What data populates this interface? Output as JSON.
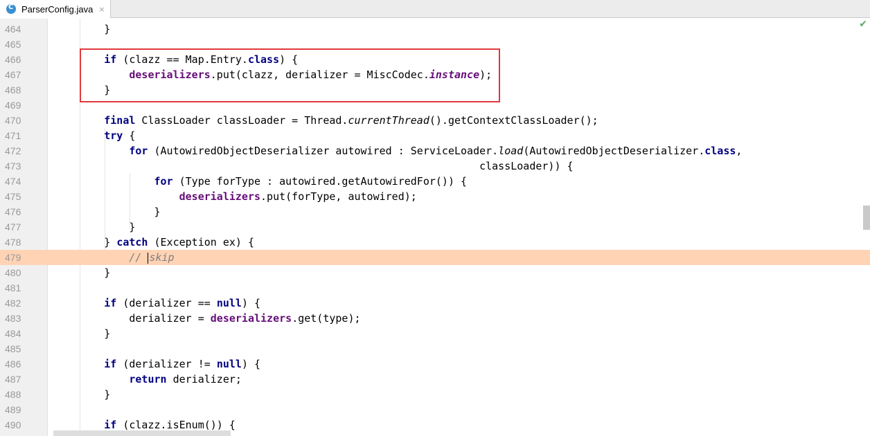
{
  "tab": {
    "icon": "java-class-icon",
    "icon_letter": "C",
    "label": "ParserConfig.java",
    "close": "×"
  },
  "status": {
    "check": "✔"
  },
  "lines": [
    {
      "num": "464",
      "html": "        }"
    },
    {
      "num": "465",
      "html": ""
    },
    {
      "num": "466",
      "html": "        <span class=\"kw\">if</span> (clazz == Map.Entry.<span class=\"kw\">class</span>) {"
    },
    {
      "num": "467",
      "html": "            <span class=\"fld\">deserializers</span>.put(clazz, derializer = MiscCodec.<span class=\"fldi\">instance</span>);"
    },
    {
      "num": "468",
      "html": "        }"
    },
    {
      "num": "469",
      "html": ""
    },
    {
      "num": "470",
      "html": "        <span class=\"kw\">final</span> ClassLoader classLoader = Thread.<span class=\"ita\">currentThread</span>().getContextClassLoader();"
    },
    {
      "num": "471",
      "html": "        <span class=\"kw\">try</span> {"
    },
    {
      "num": "472",
      "html": "            <span class=\"kw\">for</span> (AutowiredObjectDeserializer autowired : ServiceLoader.<span class=\"ita\">load</span>(AutowiredObjectDeserializer.<span class=\"kw\">class</span>,"
    },
    {
      "num": "473",
      "html": "                                                                    classLoader)) {"
    },
    {
      "num": "474",
      "html": "                <span class=\"kw\">for</span> (Type forType : autowired.getAutowiredFor()) {"
    },
    {
      "num": "475",
      "html": "                    <span class=\"fld\">deserializers</span>.put(forType, autowired);"
    },
    {
      "num": "476",
      "html": "                }"
    },
    {
      "num": "477",
      "html": "            }"
    },
    {
      "num": "478",
      "html": "        } <span class=\"kw\">catch</span> (Exception ex) {"
    },
    {
      "num": "479",
      "html": "            <span class=\"cmt\">// <span class=\"caret\"></span>skip</span>",
      "current": true
    },
    {
      "num": "480",
      "html": "        }"
    },
    {
      "num": "481",
      "html": ""
    },
    {
      "num": "482",
      "html": "        <span class=\"kw\">if</span> (derializer == <span class=\"kw\">null</span>) {"
    },
    {
      "num": "483",
      "html": "            derializer = <span class=\"fld\">deserializers</span>.get(type);"
    },
    {
      "num": "484",
      "html": "        }"
    },
    {
      "num": "485",
      "html": ""
    },
    {
      "num": "486",
      "html": "        <span class=\"kw\">if</span> (derializer != <span class=\"kw\">null</span>) {"
    },
    {
      "num": "487",
      "html": "            <span class=\"kw\">return</span> derializer;"
    },
    {
      "num": "488",
      "html": "        }"
    },
    {
      "num": "489",
      "html": ""
    },
    {
      "num": "490",
      "html": "        <span class=\"kw\">if</span> (clazz.isEnum()) {"
    }
  ]
}
